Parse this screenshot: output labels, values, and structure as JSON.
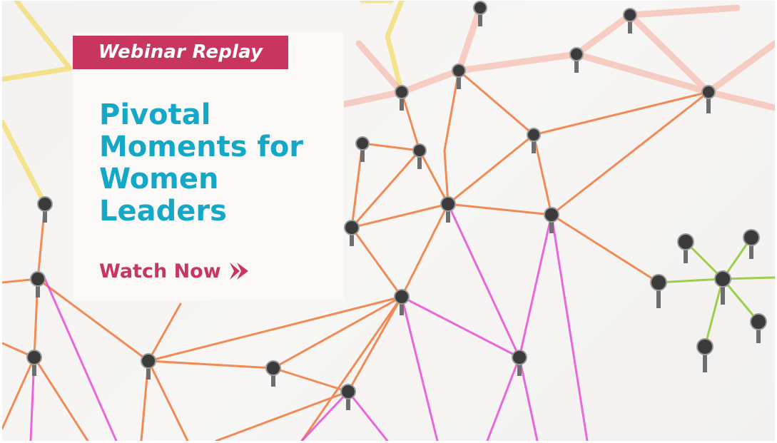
{
  "badge": {
    "label": "Webinar Replay"
  },
  "title": {
    "lines": [
      "Pivotal",
      "Moments for",
      "Women",
      "Leaders"
    ]
  },
  "cta": {
    "label": "Watch Now",
    "icon": "play-arrow-icon"
  },
  "colors": {
    "accent": "#c8365f",
    "title": "#14a7c6",
    "card": "#faf9f8",
    "background": "#f4f2f0",
    "string_orange": "#f1783a",
    "string_magenta": "#e64fd6",
    "string_green": "#93c93a",
    "string_yellow": "#f3d53a"
  }
}
